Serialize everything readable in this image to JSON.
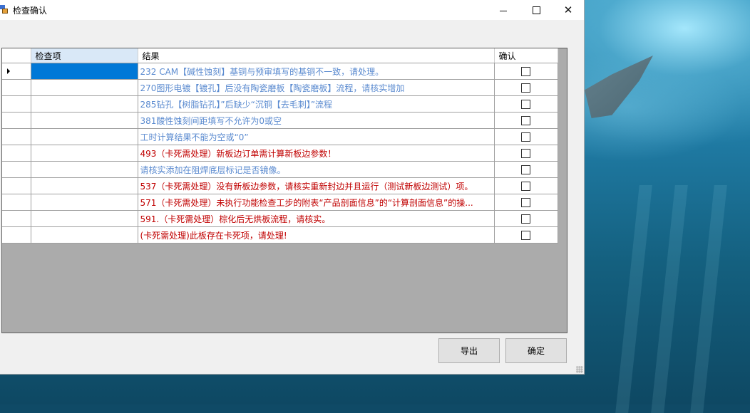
{
  "window": {
    "title": "检查确认"
  },
  "grid": {
    "columns": [
      "检查项",
      "结果",
      "确认"
    ],
    "rows": [
      {
        "item": "",
        "result": "232 CAM【碱性蚀刻】基铜与预审填写的基铜不一致，请处理。",
        "checked": false,
        "color": "#5b8bd0",
        "selected": true
      },
      {
        "item": "",
        "result": "270图形电镀【镀孔】后没有陶瓷磨板【陶瓷磨板】流程，请核实增加",
        "checked": false,
        "color": "#5b8bd0",
        "selected": false
      },
      {
        "item": "",
        "result": "285钻孔【树脂钻孔】”后缺少“沉铜【去毛刺】”流程",
        "checked": false,
        "color": "#5b8bd0",
        "selected": false
      },
      {
        "item": "",
        "result": "381酸性蚀刻间距填写不允许为0或空",
        "checked": false,
        "color": "#5b8bd0",
        "selected": false
      },
      {
        "item": "",
        "result": "工时计算结果不能为空或“0”",
        "checked": false,
        "color": "#5b8bd0",
        "selected": false
      },
      {
        "item": "",
        "result": "493（卡死需处理）新板边订单需计算新板边参数！",
        "checked": false,
        "color": "#c00000",
        "selected": false
      },
      {
        "item": "",
        "result": "请核实添加在阻焊底层标记是否镜像。",
        "checked": false,
        "color": "#5b8bd0",
        "selected": false
      },
      {
        "item": "",
        "result": "537（卡死需处理）没有新板边参数，请核实重新封边并且运行（测试新板边测试）项。",
        "checked": false,
        "color": "#c00000",
        "selected": false
      },
      {
        "item": "",
        "result": "571（卡死需处理）未执行功能检查工步的附表“产品剖面信息”的“计算剖面信息”的操...",
        "checked": false,
        "color": "#c00000",
        "selected": false
      },
      {
        "item": "",
        "result": "591.（卡死需处理）棕化后无烘板流程，请核实。",
        "checked": false,
        "color": "#c00000",
        "selected": false
      },
      {
        "item": "",
        "result": "(卡死需处理)此板存在卡死项，请处理!",
        "checked": false,
        "color": "#c00000",
        "selected": false
      }
    ]
  },
  "buttons": {
    "export": "导出",
    "confirm": "确定"
  }
}
